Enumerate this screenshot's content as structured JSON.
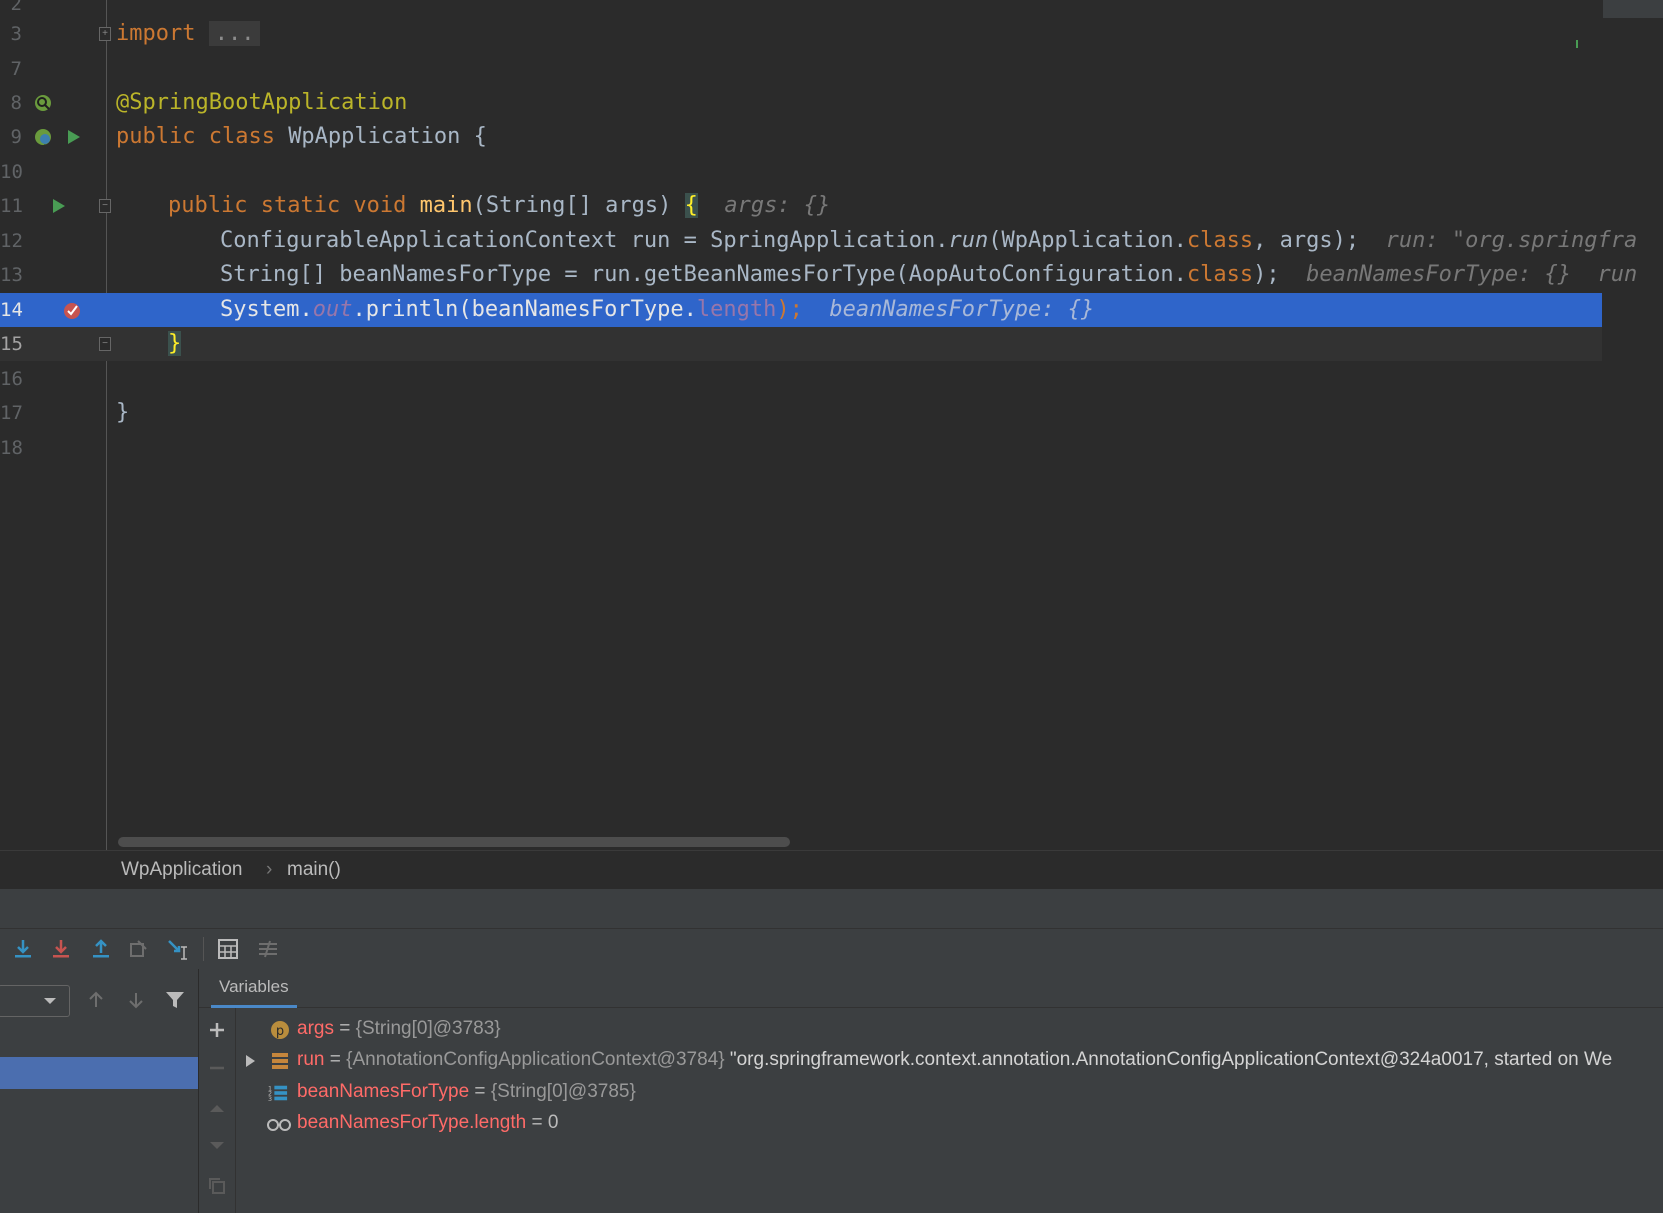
{
  "editor": {
    "lines": [
      {
        "n": "2"
      },
      {
        "n": "3",
        "import_kw": "import",
        "import_dots": "..."
      },
      {
        "n": "7"
      },
      {
        "n": "8",
        "annotation": "@SpringBootApplication"
      },
      {
        "n": "9",
        "kw": "public class ",
        "name": "WpApplication",
        "rest": " {"
      },
      {
        "n": "10"
      },
      {
        "n": "11",
        "kw": "public static void ",
        "fn": "main",
        "params": "(String[] args) ",
        "brace": "{",
        "hint": "args: {}"
      },
      {
        "n": "12",
        "p1": "ConfigurableApplicationContext run = SpringApplication.",
        "p2": "run",
        "p3": "(WpApplication.",
        "p4": "class",
        "p5": ", args);",
        "hint": "run: \"org.springfra"
      },
      {
        "n": "13",
        "p1": "String[] beanNamesForType = run.getBeanNamesForType(AopAutoConfiguration.",
        "p2": "class",
        "p3": ");",
        "hint": "beanNamesForType: {}",
        "hint2": "run"
      },
      {
        "n": "14",
        "p1": "System.",
        "p2": "out",
        "p3": ".println(beanNamesForType.",
        "p4": "length",
        "p5": ");",
        "hint": "beanNamesForType: {}"
      },
      {
        "n": "15",
        "brace": "}"
      },
      {
        "n": "16"
      },
      {
        "n": "17",
        "brace": "}"
      },
      {
        "n": "18"
      }
    ]
  },
  "breadcrumbs": {
    "class": "WpApplication",
    "sep": "›",
    "method": "main()"
  },
  "toolbar": {
    "icons": [
      "step-over-icon",
      "step-into-icon",
      "force-step-into-icon",
      "step-out-icon",
      "drop-frame-icon",
      "run-to-cursor-icon",
      "evaluate-expression-icon",
      "trace-stream-icon"
    ]
  },
  "variables": {
    "tab_label": "Variables",
    "items": [
      {
        "name": "args",
        "eq": " = ",
        "value": "{String[0]@3783}",
        "extra": ""
      },
      {
        "name": "run",
        "eq": " = ",
        "value": "{AnnotationConfigApplicationContext@3784}",
        "extra": " \"org.springframework.context.annotation.AnnotationConfigApplicationContext@324a0017, started on We"
      },
      {
        "name": "beanNamesForType",
        "eq": " = ",
        "value": "{String[0]@3785}",
        "extra": ""
      },
      {
        "name": "beanNamesForType.length",
        "eq": " = ",
        "value": "0",
        "extra": ""
      }
    ]
  },
  "colors": {
    "editor_bg": "#2b2b2b",
    "selection": "#2f65ca",
    "keyword": "#cc7832",
    "annotation": "#bbb529",
    "function": "#ffc66d",
    "field": "#9876aa",
    "var_name": "#ff6b68"
  }
}
